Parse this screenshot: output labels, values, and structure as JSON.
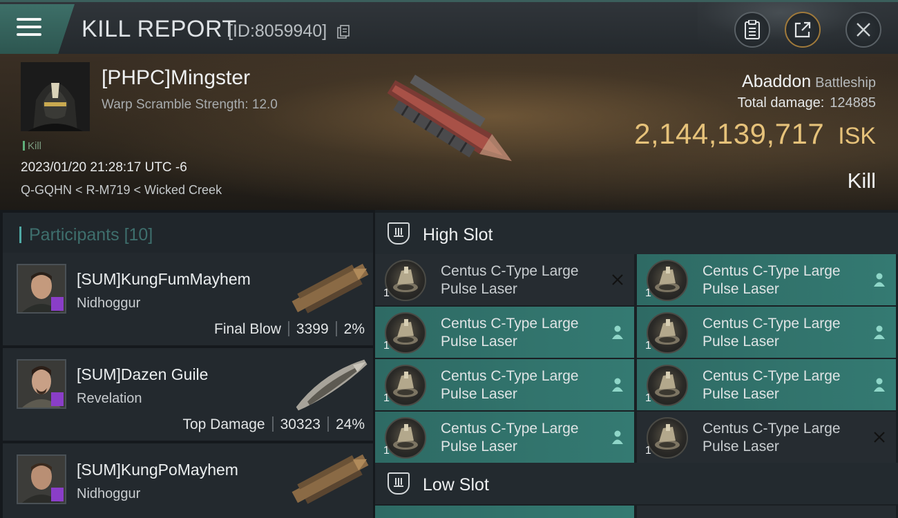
{
  "header": {
    "title": "KILL REPORT",
    "report_id": "[ID:8059940]",
    "buttons": [
      "clipboard",
      "share",
      "close"
    ]
  },
  "victim": {
    "name": "[PHPC]Mingster",
    "warp_scramble": "Warp Scramble Strength: 12.0",
    "tag": "Kill",
    "date": "2023/01/20 21:28:17 UTC -6",
    "location": "Q-GQHN < R-M719 < Wicked Creek",
    "ship_name": "Abaddon",
    "ship_class": "Battleship",
    "total_damage_label": "Total damage:",
    "total_damage": "124885",
    "isk_value": "2,144,139,717",
    "isk_unit": "ISK",
    "result": "Kill"
  },
  "participants": {
    "label": "Participants",
    "count": "[10]",
    "items": [
      {
        "name": "[SUM]KungFumMayhem",
        "ship": "Nidhoggur",
        "stat_label": "Final Blow",
        "damage": "3399",
        "percent": "2%"
      },
      {
        "name": "[SUM]Dazen Guile",
        "ship": "Revelation",
        "stat_label": "Top Damage",
        "damage": "30323",
        "percent": "24%"
      },
      {
        "name": "[SUM]KungPoMayhem",
        "ship": "Nidhoggur",
        "stat_label": "",
        "damage": "",
        "percent": ""
      }
    ]
  },
  "high_slot": {
    "label": "High Slot",
    "modules": [
      {
        "name_line1": "Centus C-Type Large",
        "name_line2": "Pulse Laser",
        "qty": "1",
        "status": "destroyed"
      },
      {
        "name_line1": "Centus C-Type Large",
        "name_line2": "Pulse Laser",
        "qty": "1",
        "status": "dropped"
      },
      {
        "name_line1": "Centus C-Type Large",
        "name_line2": "Pulse Laser",
        "qty": "1",
        "status": "dropped"
      },
      {
        "name_line1": "Centus C-Type Large",
        "name_line2": "Pulse Laser",
        "qty": "1",
        "status": "dropped"
      },
      {
        "name_line1": "Centus C-Type Large",
        "name_line2": "Pulse Laser",
        "qty": "1",
        "status": "dropped"
      },
      {
        "name_line1": "Centus C-Type Large",
        "name_line2": "Pulse Laser",
        "qty": "1",
        "status": "dropped"
      },
      {
        "name_line1": "Centus C-Type Large",
        "name_line2": "Pulse Laser",
        "qty": "1",
        "status": "dropped"
      },
      {
        "name_line1": "Centus C-Type Large",
        "name_line2": "Pulse Laser",
        "qty": "1",
        "status": "destroyed"
      }
    ]
  },
  "low_slot": {
    "label": "Low Slot"
  },
  "colors": {
    "accent_teal": "#347a72",
    "isk_gold": "#e6c27a",
    "badge_purple": "#8a3ec8"
  }
}
